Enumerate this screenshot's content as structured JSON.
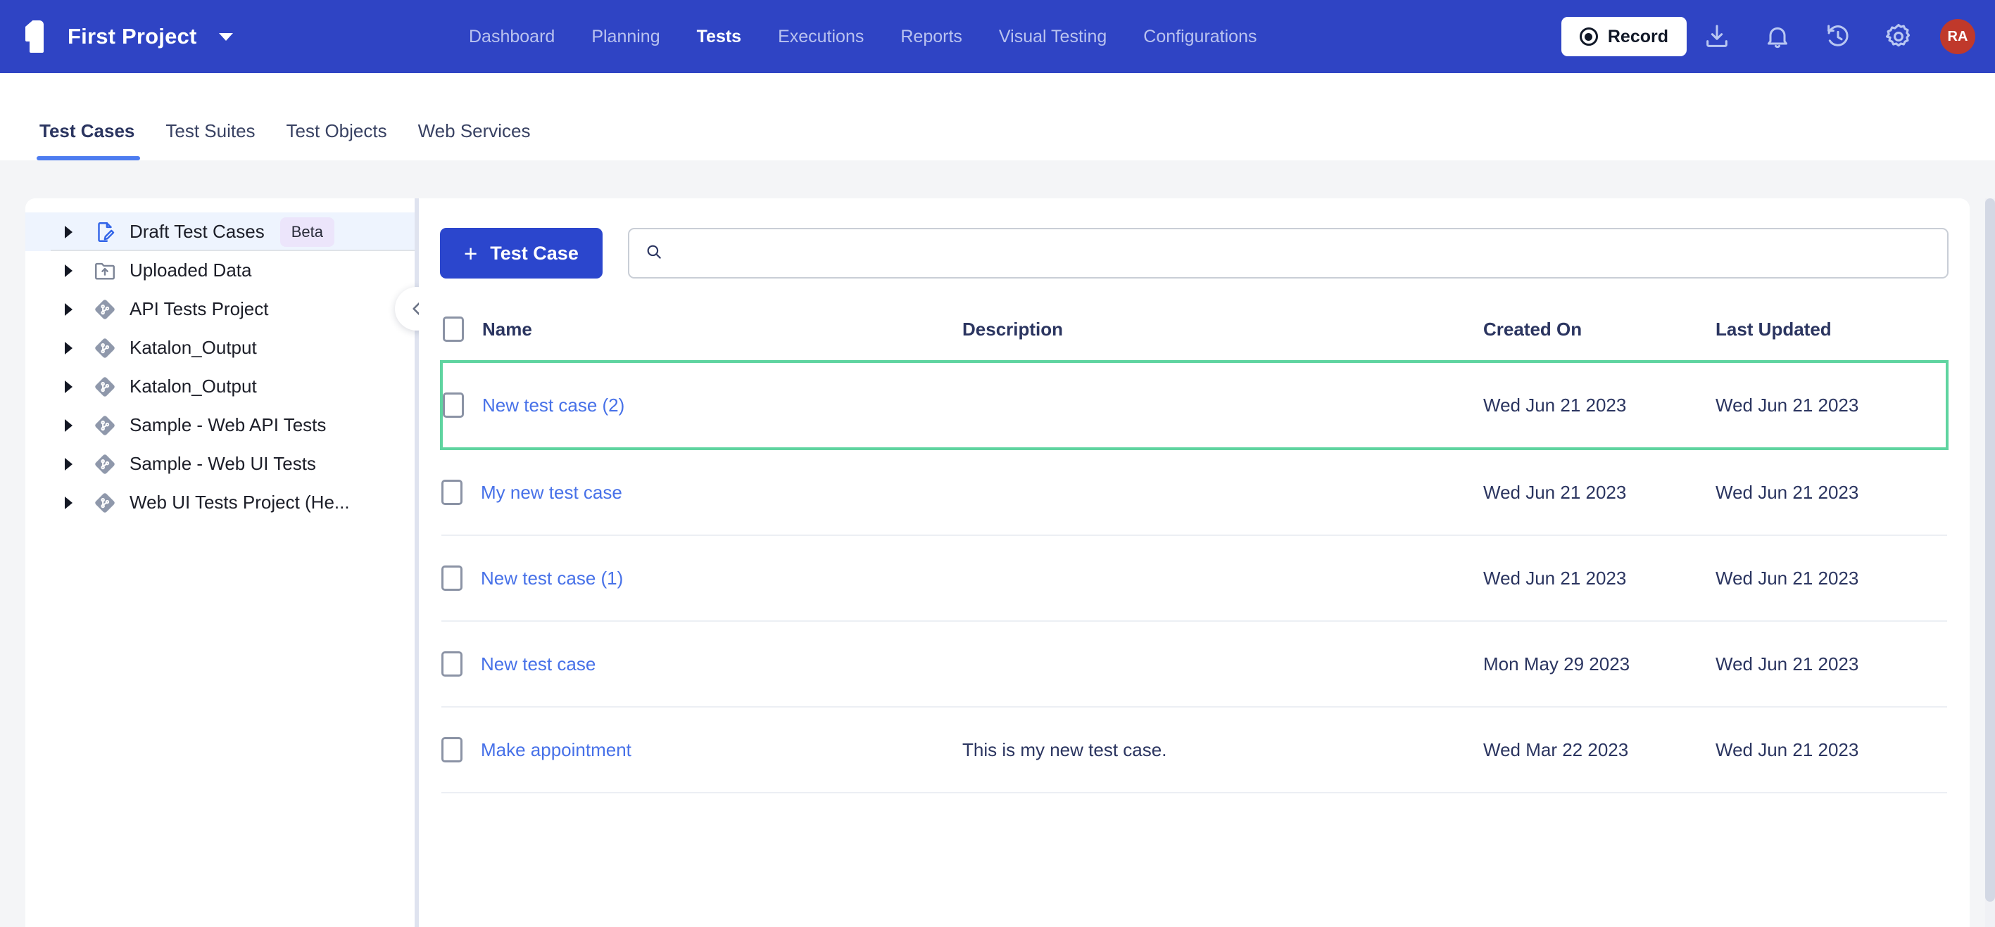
{
  "topbar": {
    "logo_name": "katalon-logo",
    "project_name": "First Project",
    "nav": [
      {
        "label": "Dashboard",
        "active": false
      },
      {
        "label": "Planning",
        "active": false
      },
      {
        "label": "Tests",
        "active": true
      },
      {
        "label": "Executions",
        "active": false
      },
      {
        "label": "Reports",
        "active": false
      },
      {
        "label": "Visual Testing",
        "active": false
      },
      {
        "label": "Configurations",
        "active": false
      }
    ],
    "record_label": "Record",
    "icons": [
      "download-icon",
      "bell-icon",
      "history-icon",
      "gear-icon"
    ],
    "avatar_initials": "RA",
    "avatar_color": "#c0392b",
    "background_color": "#2f44c4"
  },
  "subtabs": [
    {
      "label": "Test Cases",
      "active": true
    },
    {
      "label": "Test Suites",
      "active": false
    },
    {
      "label": "Test Objects",
      "active": false
    },
    {
      "label": "Web Services",
      "active": false
    }
  ],
  "sidebar": {
    "items": [
      {
        "label": "Draft Test Cases",
        "icon": "draft-document-icon",
        "badge": "Beta",
        "selected": true
      },
      {
        "label": "Uploaded Data",
        "icon": "upload-folder-icon",
        "badge": "",
        "selected": false
      },
      {
        "label": "API Tests Project",
        "icon": "git-branch-icon",
        "badge": "",
        "selected": false
      },
      {
        "label": "Katalon_Output",
        "icon": "git-branch-icon",
        "badge": "",
        "selected": false
      },
      {
        "label": "Katalon_Output",
        "icon": "git-branch-icon",
        "badge": "",
        "selected": false
      },
      {
        "label": "Sample - Web API Tests",
        "icon": "git-branch-icon",
        "badge": "",
        "selected": false
      },
      {
        "label": "Sample - Web UI Tests",
        "icon": "git-branch-icon",
        "badge": "",
        "selected": false
      },
      {
        "label": "Web UI Tests Project (He...",
        "icon": "git-branch-icon",
        "badge": "",
        "selected": false
      }
    ],
    "collapse_icon": "chevron-left-icon"
  },
  "toolbar": {
    "new_test_case_label": "Test Case",
    "new_test_case_plus": "+",
    "search_value": "",
    "search_placeholder": "",
    "search_icon": "search-icon"
  },
  "table": {
    "columns": [
      "Name",
      "Description",
      "Created On",
      "Last Updated"
    ],
    "rows": [
      {
        "name": "New test case (2)",
        "description": "",
        "created_on": "Wed Jun 21 2023",
        "last_updated": "Wed Jun 21 2023",
        "highlighted": true
      },
      {
        "name": "My new test case",
        "description": "",
        "created_on": "Wed Jun 21 2023",
        "last_updated": "Wed Jun 21 2023",
        "highlighted": false
      },
      {
        "name": "New test case (1)",
        "description": "",
        "created_on": "Wed Jun 21 2023",
        "last_updated": "Wed Jun 21 2023",
        "highlighted": false
      },
      {
        "name": "New test case",
        "description": "",
        "created_on": "Mon May 29 2023",
        "last_updated": "Wed Jun 21 2023",
        "highlighted": false
      },
      {
        "name": "Make appointment",
        "description": "This is my new test case.",
        "created_on": "Wed Mar 22 2023",
        "last_updated": "Wed Jun 21 2023",
        "highlighted": false
      }
    ],
    "highlight_color": "#5fd4a0",
    "link_color": "#4771e8"
  }
}
